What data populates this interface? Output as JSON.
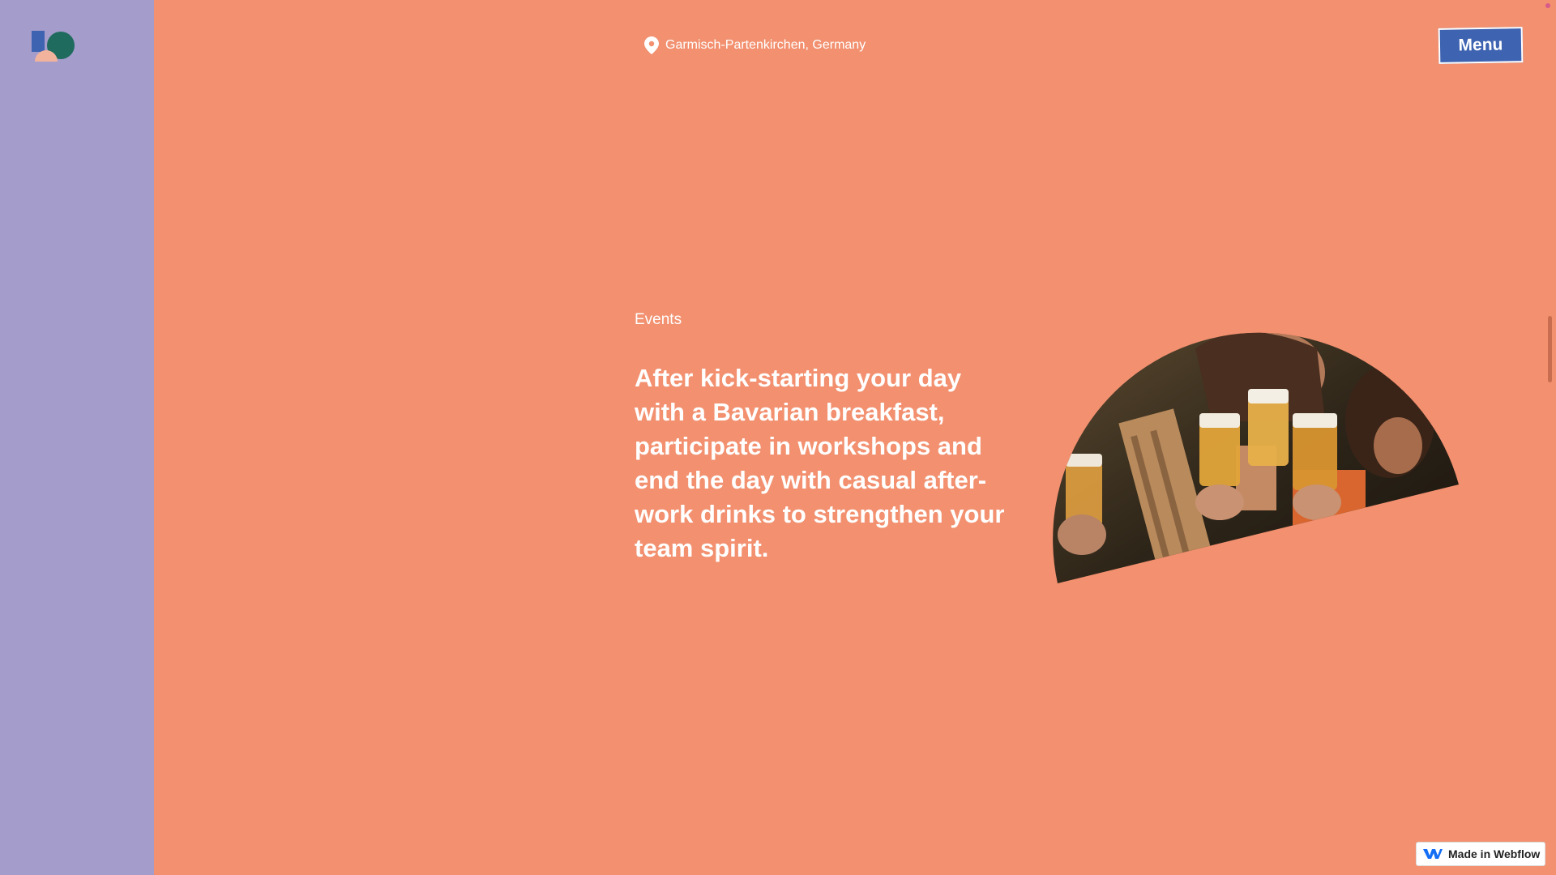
{
  "header": {
    "logo_icon": "brand-logo-icon",
    "location_icon": "location-pin-icon",
    "location_text": "Garmisch-Partenkirchen, Germany",
    "menu_label": "Menu"
  },
  "content": {
    "eyebrow": "Events",
    "headline": "After kick-starting your day with a Bavarian breakfast, participate in workshops and end the day with casual after-work drinks to strengthen your team spirit."
  },
  "badge": {
    "icon": "webflow-logo-icon",
    "label": "Made in Webflow"
  },
  "colors": {
    "sidebar": "#a49ccb",
    "background": "#f2906f",
    "menu_button": "#3e63b1",
    "text": "#ffffff"
  }
}
